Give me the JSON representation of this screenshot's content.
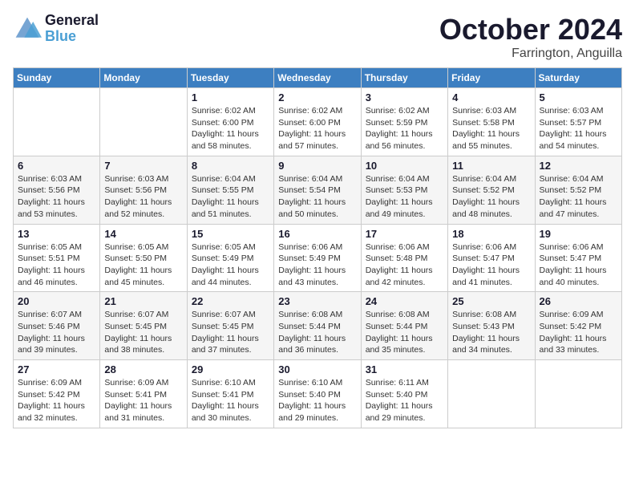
{
  "header": {
    "logo_line1": "General",
    "logo_line2": "Blue",
    "month": "October 2024",
    "location": "Farrington, Anguilla"
  },
  "days_of_week": [
    "Sunday",
    "Monday",
    "Tuesday",
    "Wednesday",
    "Thursday",
    "Friday",
    "Saturday"
  ],
  "weeks": [
    [
      null,
      null,
      {
        "day": "1",
        "sunrise": "Sunrise: 6:02 AM",
        "sunset": "Sunset: 6:00 PM",
        "daylight": "Daylight: 11 hours and 58 minutes."
      },
      {
        "day": "2",
        "sunrise": "Sunrise: 6:02 AM",
        "sunset": "Sunset: 6:00 PM",
        "daylight": "Daylight: 11 hours and 57 minutes."
      },
      {
        "day": "3",
        "sunrise": "Sunrise: 6:02 AM",
        "sunset": "Sunset: 5:59 PM",
        "daylight": "Daylight: 11 hours and 56 minutes."
      },
      {
        "day": "4",
        "sunrise": "Sunrise: 6:03 AM",
        "sunset": "Sunset: 5:58 PM",
        "daylight": "Daylight: 11 hours and 55 minutes."
      },
      {
        "day": "5",
        "sunrise": "Sunrise: 6:03 AM",
        "sunset": "Sunset: 5:57 PM",
        "daylight": "Daylight: 11 hours and 54 minutes."
      }
    ],
    [
      {
        "day": "6",
        "sunrise": "Sunrise: 6:03 AM",
        "sunset": "Sunset: 5:56 PM",
        "daylight": "Daylight: 11 hours and 53 minutes."
      },
      {
        "day": "7",
        "sunrise": "Sunrise: 6:03 AM",
        "sunset": "Sunset: 5:56 PM",
        "daylight": "Daylight: 11 hours and 52 minutes."
      },
      {
        "day": "8",
        "sunrise": "Sunrise: 6:04 AM",
        "sunset": "Sunset: 5:55 PM",
        "daylight": "Daylight: 11 hours and 51 minutes."
      },
      {
        "day": "9",
        "sunrise": "Sunrise: 6:04 AM",
        "sunset": "Sunset: 5:54 PM",
        "daylight": "Daylight: 11 hours and 50 minutes."
      },
      {
        "day": "10",
        "sunrise": "Sunrise: 6:04 AM",
        "sunset": "Sunset: 5:53 PM",
        "daylight": "Daylight: 11 hours and 49 minutes."
      },
      {
        "day": "11",
        "sunrise": "Sunrise: 6:04 AM",
        "sunset": "Sunset: 5:52 PM",
        "daylight": "Daylight: 11 hours and 48 minutes."
      },
      {
        "day": "12",
        "sunrise": "Sunrise: 6:04 AM",
        "sunset": "Sunset: 5:52 PM",
        "daylight": "Daylight: 11 hours and 47 minutes."
      }
    ],
    [
      {
        "day": "13",
        "sunrise": "Sunrise: 6:05 AM",
        "sunset": "Sunset: 5:51 PM",
        "daylight": "Daylight: 11 hours and 46 minutes."
      },
      {
        "day": "14",
        "sunrise": "Sunrise: 6:05 AM",
        "sunset": "Sunset: 5:50 PM",
        "daylight": "Daylight: 11 hours and 45 minutes."
      },
      {
        "day": "15",
        "sunrise": "Sunrise: 6:05 AM",
        "sunset": "Sunset: 5:49 PM",
        "daylight": "Daylight: 11 hours and 44 minutes."
      },
      {
        "day": "16",
        "sunrise": "Sunrise: 6:06 AM",
        "sunset": "Sunset: 5:49 PM",
        "daylight": "Daylight: 11 hours and 43 minutes."
      },
      {
        "day": "17",
        "sunrise": "Sunrise: 6:06 AM",
        "sunset": "Sunset: 5:48 PM",
        "daylight": "Daylight: 11 hours and 42 minutes."
      },
      {
        "day": "18",
        "sunrise": "Sunrise: 6:06 AM",
        "sunset": "Sunset: 5:47 PM",
        "daylight": "Daylight: 11 hours and 41 minutes."
      },
      {
        "day": "19",
        "sunrise": "Sunrise: 6:06 AM",
        "sunset": "Sunset: 5:47 PM",
        "daylight": "Daylight: 11 hours and 40 minutes."
      }
    ],
    [
      {
        "day": "20",
        "sunrise": "Sunrise: 6:07 AM",
        "sunset": "Sunset: 5:46 PM",
        "daylight": "Daylight: 11 hours and 39 minutes."
      },
      {
        "day": "21",
        "sunrise": "Sunrise: 6:07 AM",
        "sunset": "Sunset: 5:45 PM",
        "daylight": "Daylight: 11 hours and 38 minutes."
      },
      {
        "day": "22",
        "sunrise": "Sunrise: 6:07 AM",
        "sunset": "Sunset: 5:45 PM",
        "daylight": "Daylight: 11 hours and 37 minutes."
      },
      {
        "day": "23",
        "sunrise": "Sunrise: 6:08 AM",
        "sunset": "Sunset: 5:44 PM",
        "daylight": "Daylight: 11 hours and 36 minutes."
      },
      {
        "day": "24",
        "sunrise": "Sunrise: 6:08 AM",
        "sunset": "Sunset: 5:44 PM",
        "daylight": "Daylight: 11 hours and 35 minutes."
      },
      {
        "day": "25",
        "sunrise": "Sunrise: 6:08 AM",
        "sunset": "Sunset: 5:43 PM",
        "daylight": "Daylight: 11 hours and 34 minutes."
      },
      {
        "day": "26",
        "sunrise": "Sunrise: 6:09 AM",
        "sunset": "Sunset: 5:42 PM",
        "daylight": "Daylight: 11 hours and 33 minutes."
      }
    ],
    [
      {
        "day": "27",
        "sunrise": "Sunrise: 6:09 AM",
        "sunset": "Sunset: 5:42 PM",
        "daylight": "Daylight: 11 hours and 32 minutes."
      },
      {
        "day": "28",
        "sunrise": "Sunrise: 6:09 AM",
        "sunset": "Sunset: 5:41 PM",
        "daylight": "Daylight: 11 hours and 31 minutes."
      },
      {
        "day": "29",
        "sunrise": "Sunrise: 6:10 AM",
        "sunset": "Sunset: 5:41 PM",
        "daylight": "Daylight: 11 hours and 30 minutes."
      },
      {
        "day": "30",
        "sunrise": "Sunrise: 6:10 AM",
        "sunset": "Sunset: 5:40 PM",
        "daylight": "Daylight: 11 hours and 29 minutes."
      },
      {
        "day": "31",
        "sunrise": "Sunrise: 6:11 AM",
        "sunset": "Sunset: 5:40 PM",
        "daylight": "Daylight: 11 hours and 29 minutes."
      },
      null,
      null
    ]
  ]
}
